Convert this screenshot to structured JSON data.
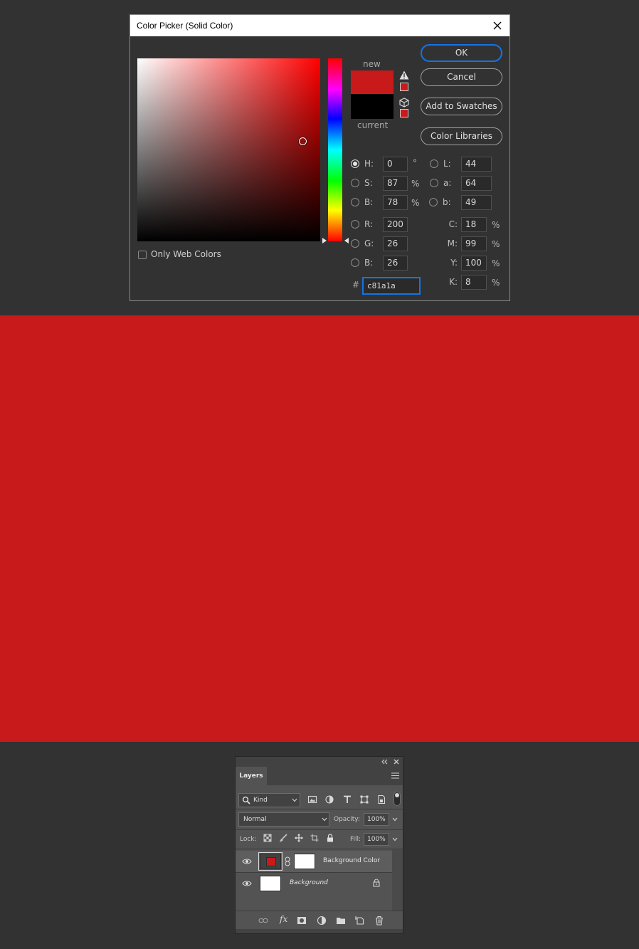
{
  "colors": {
    "new": "#c81a1a",
    "current": "#000000",
    "canvas_fill": "#c81a1a",
    "accent": "#1473e6"
  },
  "dialog": {
    "title": "Color Picker (Solid Color)",
    "new_label": "new",
    "current_label": "current",
    "buttons": {
      "ok": "OK",
      "cancel": "Cancel",
      "add_to_swatches": "Add to Swatches",
      "color_libraries": "Color Libraries"
    },
    "only_web_colors": "Only Web Colors",
    "hsb": {
      "h_label": "H:",
      "h": "0",
      "h_unit": "°",
      "s_label": "S:",
      "s": "87",
      "s_unit": "%",
      "b_label": "B:",
      "b": "78",
      "b_unit": "%"
    },
    "lab": {
      "l_label": "L:",
      "l": "44",
      "a_label": "a:",
      "a": "64",
      "b_label": "b:",
      "b": "49"
    },
    "rgb": {
      "r_label": "R:",
      "r": "200",
      "g_label": "G:",
      "g": "26",
      "b_label": "B:",
      "b": "26"
    },
    "cmyk": {
      "c_label": "C:",
      "c": "18",
      "m_label": "M:",
      "m": "99",
      "y_label": "Y:",
      "y": "100",
      "k_label": "K:",
      "k": "8",
      "unit": "%"
    },
    "hex_label": "#",
    "hex": "c81a1a"
  },
  "layers_panel": {
    "tab": "Layers",
    "filter_kind": "Kind",
    "blend_mode": "Normal",
    "opacity_label": "Opacity:",
    "opacity": "100%",
    "lock_label": "Lock:",
    "fill_label": "Fill:",
    "fill": "100%",
    "layers": [
      {
        "name": "Background Color",
        "selected": true,
        "thumb_color": "#c81a1a"
      },
      {
        "name": "Background",
        "selected": false,
        "thumb_color": "#ffffff"
      }
    ],
    "icons": [
      "search-icon",
      "image-filter-icon",
      "adjustment-filter-icon",
      "type-filter-icon",
      "shape-filter-icon",
      "smart-object-filter-icon",
      "link-layers-icon",
      "fx-icon",
      "mask-icon",
      "adjustment-layer-icon",
      "folder-icon",
      "new-layer-icon",
      "trash-icon"
    ]
  }
}
